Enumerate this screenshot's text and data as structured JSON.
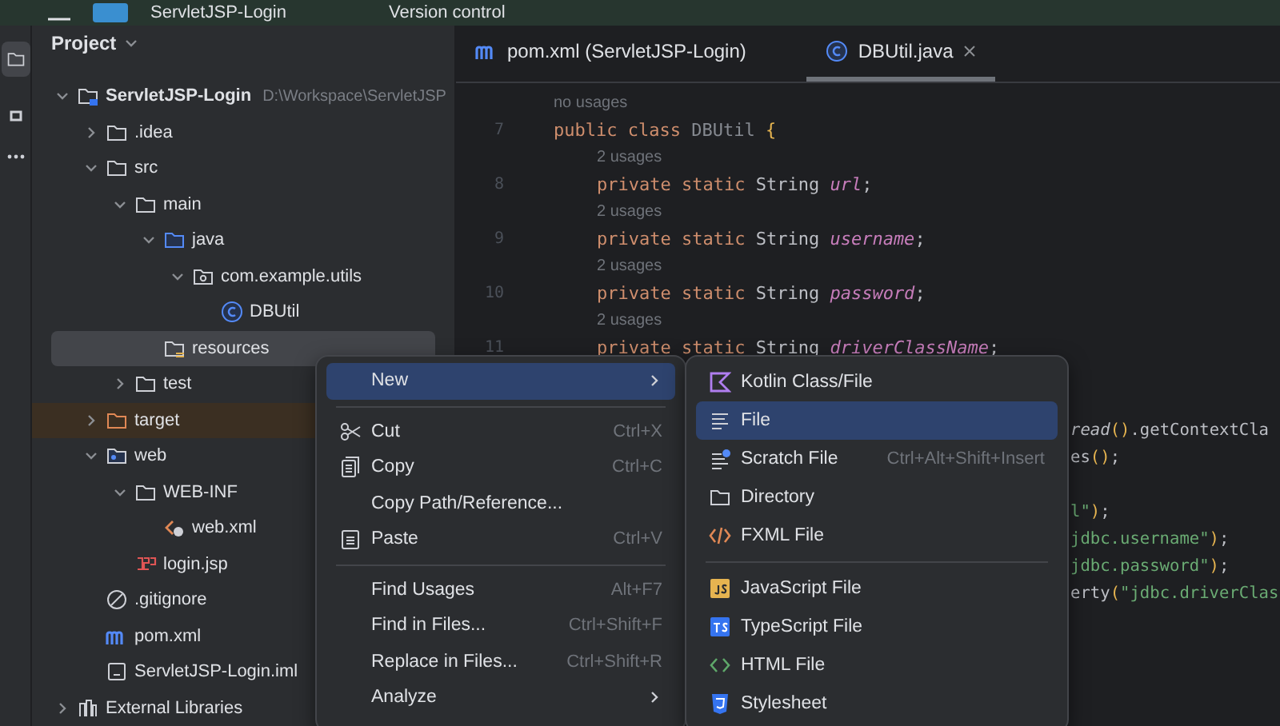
{
  "title_bar": {
    "project": "ServletJSP-Login",
    "vcs": "Version control"
  },
  "project_panel": {
    "title": "Project",
    "tree": [
      {
        "label": "ServletJSP-Login",
        "path": "D:\\Workspace\\ServletJSP",
        "kind": "project",
        "expanded": true,
        "selected": false,
        "children": [
          {
            "label": ".idea",
            "kind": "folder",
            "expanded": false,
            "selected": false
          },
          {
            "label": "src",
            "kind": "folder",
            "expanded": true,
            "selected": false,
            "children": [
              {
                "label": "main",
                "kind": "folder",
                "expanded": true,
                "selected": false,
                "children": [
                  {
                    "label": "java",
                    "kind": "source",
                    "expanded": true,
                    "selected": false,
                    "children": [
                      {
                        "label": "com.example.utils",
                        "kind": "package",
                        "expanded": true,
                        "selected": false,
                        "children": [
                          {
                            "label": "DBUtil",
                            "kind": "class",
                            "selected": false
                          }
                        ]
                      }
                    ]
                  },
                  {
                    "label": "resources",
                    "kind": "resources",
                    "selected": true
                  }
                ]
              },
              {
                "label": "test",
                "kind": "folder",
                "expanded": false,
                "selected": false
              }
            ]
          },
          {
            "label": "target",
            "kind": "excluded",
            "expanded": false,
            "selected": false
          },
          {
            "label": "web",
            "kind": "web",
            "expanded": true,
            "selected": false,
            "children": [
              {
                "label": "WEB-INF",
                "kind": "folder",
                "expanded": true,
                "selected": false,
                "children": [
                  {
                    "label": "web.xml",
                    "kind": "xml",
                    "selected": false
                  }
                ]
              },
              {
                "label": "login.jsp",
                "kind": "jsp",
                "selected": false
              }
            ]
          },
          {
            "label": ".gitignore",
            "kind": "gitignore",
            "selected": false
          },
          {
            "label": "pom.xml",
            "kind": "maven",
            "selected": false
          },
          {
            "label": "ServletJSP-Login.iml",
            "kind": "iml",
            "selected": false
          }
        ]
      },
      {
        "label": "External Libraries",
        "kind": "library",
        "expanded": false,
        "selected": false
      }
    ]
  },
  "tabs": [
    {
      "label": "pom.xml (ServletJSP-Login)",
      "kind": "maven",
      "selected": false,
      "closable": false
    },
    {
      "label": "DBUtil.java",
      "kind": "class",
      "selected": true,
      "closable": true
    }
  ],
  "code": [
    {
      "kind": "hint",
      "text": "no usages"
    },
    {
      "kind": "code",
      "number": "7",
      "parts": [
        {
          "t": "public class ",
          "kind": "keyword"
        },
        {
          "t": "DBUtil ",
          "kind": "unused"
        },
        {
          "t": "{",
          "kind": "brace"
        }
      ]
    },
    {
      "kind": "member-hint",
      "text": "2 usages"
    },
    {
      "kind": "member-code",
      "number": "8",
      "parts": [
        {
          "t": "private static ",
          "kind": "keyword"
        },
        {
          "t": "String ",
          "kind": "plain"
        },
        {
          "t": "url",
          "kind": "field"
        },
        {
          "t": ";",
          "kind": "plain"
        }
      ]
    },
    {
      "kind": "member-hint",
      "text": "2 usages"
    },
    {
      "kind": "member-code",
      "number": "9",
      "parts": [
        {
          "t": "private static ",
          "kind": "keyword"
        },
        {
          "t": "String ",
          "kind": "plain"
        },
        {
          "t": "username",
          "kind": "field"
        },
        {
          "t": ";",
          "kind": "plain"
        }
      ]
    },
    {
      "kind": "member-hint",
      "text": "2 usages"
    },
    {
      "kind": "member-code",
      "number": "10",
      "parts": [
        {
          "t": "private static ",
          "kind": "keyword"
        },
        {
          "t": "String ",
          "kind": "plain"
        },
        {
          "t": "password",
          "kind": "field"
        },
        {
          "t": ";",
          "kind": "plain"
        }
      ]
    },
    {
      "kind": "member-hint",
      "text": "2 usages"
    },
    {
      "kind": "member-code",
      "number": "11",
      "parts": [
        {
          "t": "private static ",
          "kind": "keyword"
        },
        {
          "t": "String ",
          "kind": "plain"
        },
        {
          "t": "driverClassName",
          "kind": "field"
        },
        {
          "t": ";",
          "kind": "plain"
        }
      ]
    },
    {
      "kind": "blank"
    },
    {
      "kind": "blank"
    },
    {
      "kind": "fragment",
      "parts": [
        {
          "t": "read",
          "kind": "static"
        },
        {
          "t": "()",
          "kind": "brace"
        },
        {
          "t": ".getContextCla",
          "kind": "plain"
        }
      ]
    },
    {
      "kind": "fragment",
      "parts": [
        {
          "t": "es",
          "kind": "plain"
        },
        {
          "t": "()",
          "kind": "brace"
        },
        {
          "t": ";",
          "kind": "plain"
        }
      ]
    },
    {
      "kind": "blank"
    },
    {
      "kind": "fragment",
      "parts": [
        {
          "t": "l\"",
          "kind": "string"
        },
        {
          "t": ")",
          "kind": "brace"
        },
        {
          "t": ";",
          "kind": "plain"
        }
      ]
    },
    {
      "kind": "fragment",
      "parts": [
        {
          "t": "jdbc.username\"",
          "kind": "string"
        },
        {
          "t": ")",
          "kind": "brace"
        },
        {
          "t": ";",
          "kind": "plain"
        }
      ]
    },
    {
      "kind": "fragment",
      "parts": [
        {
          "t": "jdbc.password\"",
          "kind": "string"
        },
        {
          "t": ")",
          "kind": "brace"
        },
        {
          "t": ";",
          "kind": "plain"
        }
      ]
    },
    {
      "kind": "fragment",
      "parts": [
        {
          "t": "erty",
          "kind": "plain"
        },
        {
          "t": "(",
          "kind": "brace"
        },
        {
          "t": "\"jdbc.driverClas",
          "kind": "string"
        }
      ]
    }
  ],
  "context_menu": {
    "groups": [
      [
        {
          "label": "New",
          "kind": "plain",
          "submenu": true,
          "selected": true
        }
      ],
      [
        {
          "label": "Cut",
          "kind": "scissors",
          "shortcut": "Ctrl+X",
          "submenu": false,
          "selected": false
        },
        {
          "label": "Copy",
          "kind": "copy",
          "shortcut": "Ctrl+C",
          "submenu": false,
          "selected": false
        },
        {
          "label": "Copy Path/Reference...",
          "kind": "plain",
          "submenu": false,
          "selected": false
        },
        {
          "label": "Paste",
          "kind": "paste",
          "shortcut": "Ctrl+V",
          "submenu": false,
          "selected": false
        }
      ],
      [
        {
          "label": "Find Usages",
          "kind": "plain",
          "shortcut": "Alt+F7",
          "submenu": false,
          "selected": false
        },
        {
          "label": "Find in Files...",
          "kind": "plain",
          "shortcut": "Ctrl+Shift+F",
          "submenu": false,
          "selected": false
        },
        {
          "label": "Replace in Files...",
          "kind": "plain",
          "shortcut": "Ctrl+Shift+R",
          "submenu": false,
          "selected": false
        },
        {
          "label": "Analyze",
          "kind": "plain",
          "submenu": true,
          "selected": false
        }
      ]
    ]
  },
  "new_submenu": {
    "groups": [
      [
        {
          "label": "Kotlin Class/File",
          "kind": "kotlin",
          "selected": false
        },
        {
          "label": "File",
          "kind": "file",
          "selected": true
        },
        {
          "label": "Scratch File",
          "kind": "scratch",
          "shortcut": "Ctrl+Alt+Shift+Insert",
          "selected": false
        },
        {
          "label": "Directory",
          "kind": "folder",
          "selected": false
        },
        {
          "label": "FXML File",
          "kind": "fxml",
          "selected": false
        }
      ],
      [
        {
          "label": "JavaScript File",
          "kind": "js",
          "selected": false
        },
        {
          "label": "TypeScript File",
          "kind": "ts",
          "selected": false
        },
        {
          "label": "HTML File",
          "kind": "html",
          "selected": false
        },
        {
          "label": "Stylesheet",
          "kind": "css",
          "selected": false
        }
      ]
    ]
  }
}
